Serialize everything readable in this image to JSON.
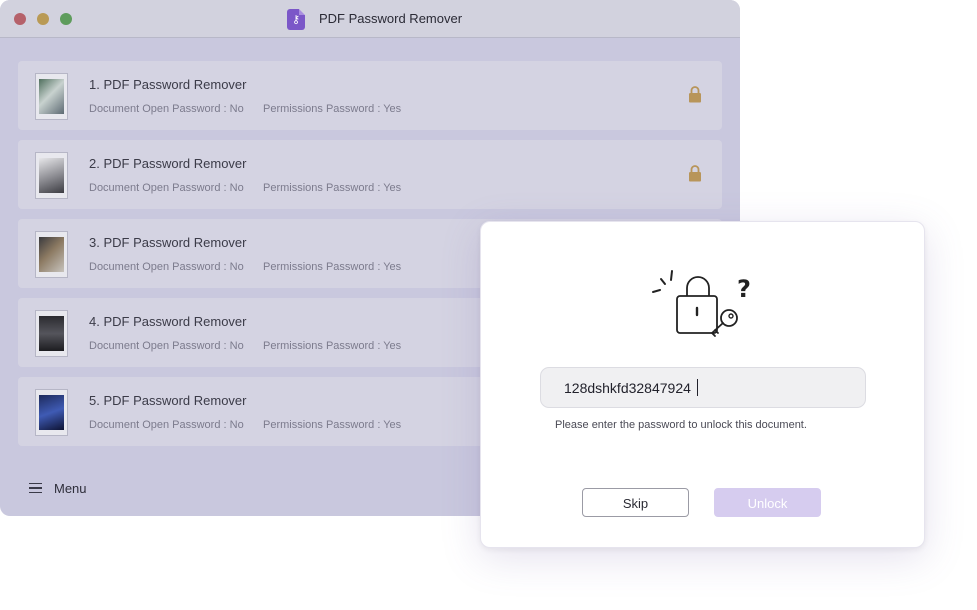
{
  "window": {
    "title": "PDF Password Remover",
    "app_icon": "pdf-key-icon"
  },
  "files": [
    {
      "name": "1. PDF Password Remover",
      "open_password": "Document Open Password : No",
      "permissions_password": "Permissions Password : Yes",
      "locked": true
    },
    {
      "name": "2. PDF Password Remover",
      "open_password": "Document Open Password : No",
      "permissions_password": "Permissions Password : Yes",
      "locked": true
    },
    {
      "name": "3. PDF Password Remover",
      "open_password": "Document Open Password : No",
      "permissions_password": "Permissions Password : Yes",
      "locked": false
    },
    {
      "name": "4. PDF Password Remover",
      "open_password": "Document Open Password : No",
      "permissions_password": "Permissions Password : Yes",
      "locked": false
    },
    {
      "name": "5. PDF Password Remover",
      "open_password": "Document Open Password : No",
      "permissions_password": "Permissions Password : Yes",
      "locked": false
    }
  ],
  "menu": {
    "label": "Menu"
  },
  "dialog": {
    "password_value": "128dshkfd32847924",
    "hint": "Please enter the password to unlock this document.",
    "skip_label": "Skip",
    "unlock_label": "Unlock"
  },
  "colors": {
    "accent": "#7b57c8",
    "unlock_disabled": "#d6ccef",
    "lock_badge": "#b8955a"
  }
}
